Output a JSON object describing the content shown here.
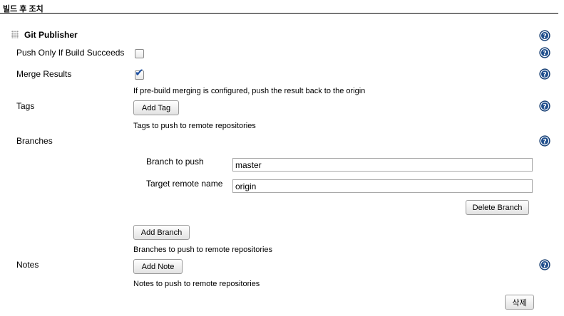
{
  "section": {
    "title": "빌드 후 조치"
  },
  "publisher": {
    "title": "Git Publisher",
    "push_only_if_success": {
      "label": "Push Only If Build Succeeds",
      "checked": false
    },
    "merge_results": {
      "label": "Merge Results",
      "checked": true,
      "hint": "If pre-build merging is configured, push the result back to the origin"
    },
    "tags": {
      "label": "Tags",
      "add_button": "Add Tag",
      "hint": "Tags to push to remote repositories"
    },
    "branches": {
      "label": "Branches",
      "branch_to_push_label": "Branch to push",
      "branch_to_push_value": "master",
      "target_remote_label": "Target remote name",
      "target_remote_value": "origin",
      "delete_button": "Delete Branch",
      "add_button": "Add Branch",
      "hint": "Branches to push to remote repositories"
    },
    "notes": {
      "label": "Notes",
      "add_button": "Add Note",
      "hint": "Notes to push to remote repositories"
    },
    "delete_button": "삭제"
  },
  "icons": {
    "help": "help-icon",
    "drag": "drag-handle-icon"
  },
  "colors": {
    "help_icon": "#1f4e8c",
    "checkmark": "#1c4fa0"
  }
}
